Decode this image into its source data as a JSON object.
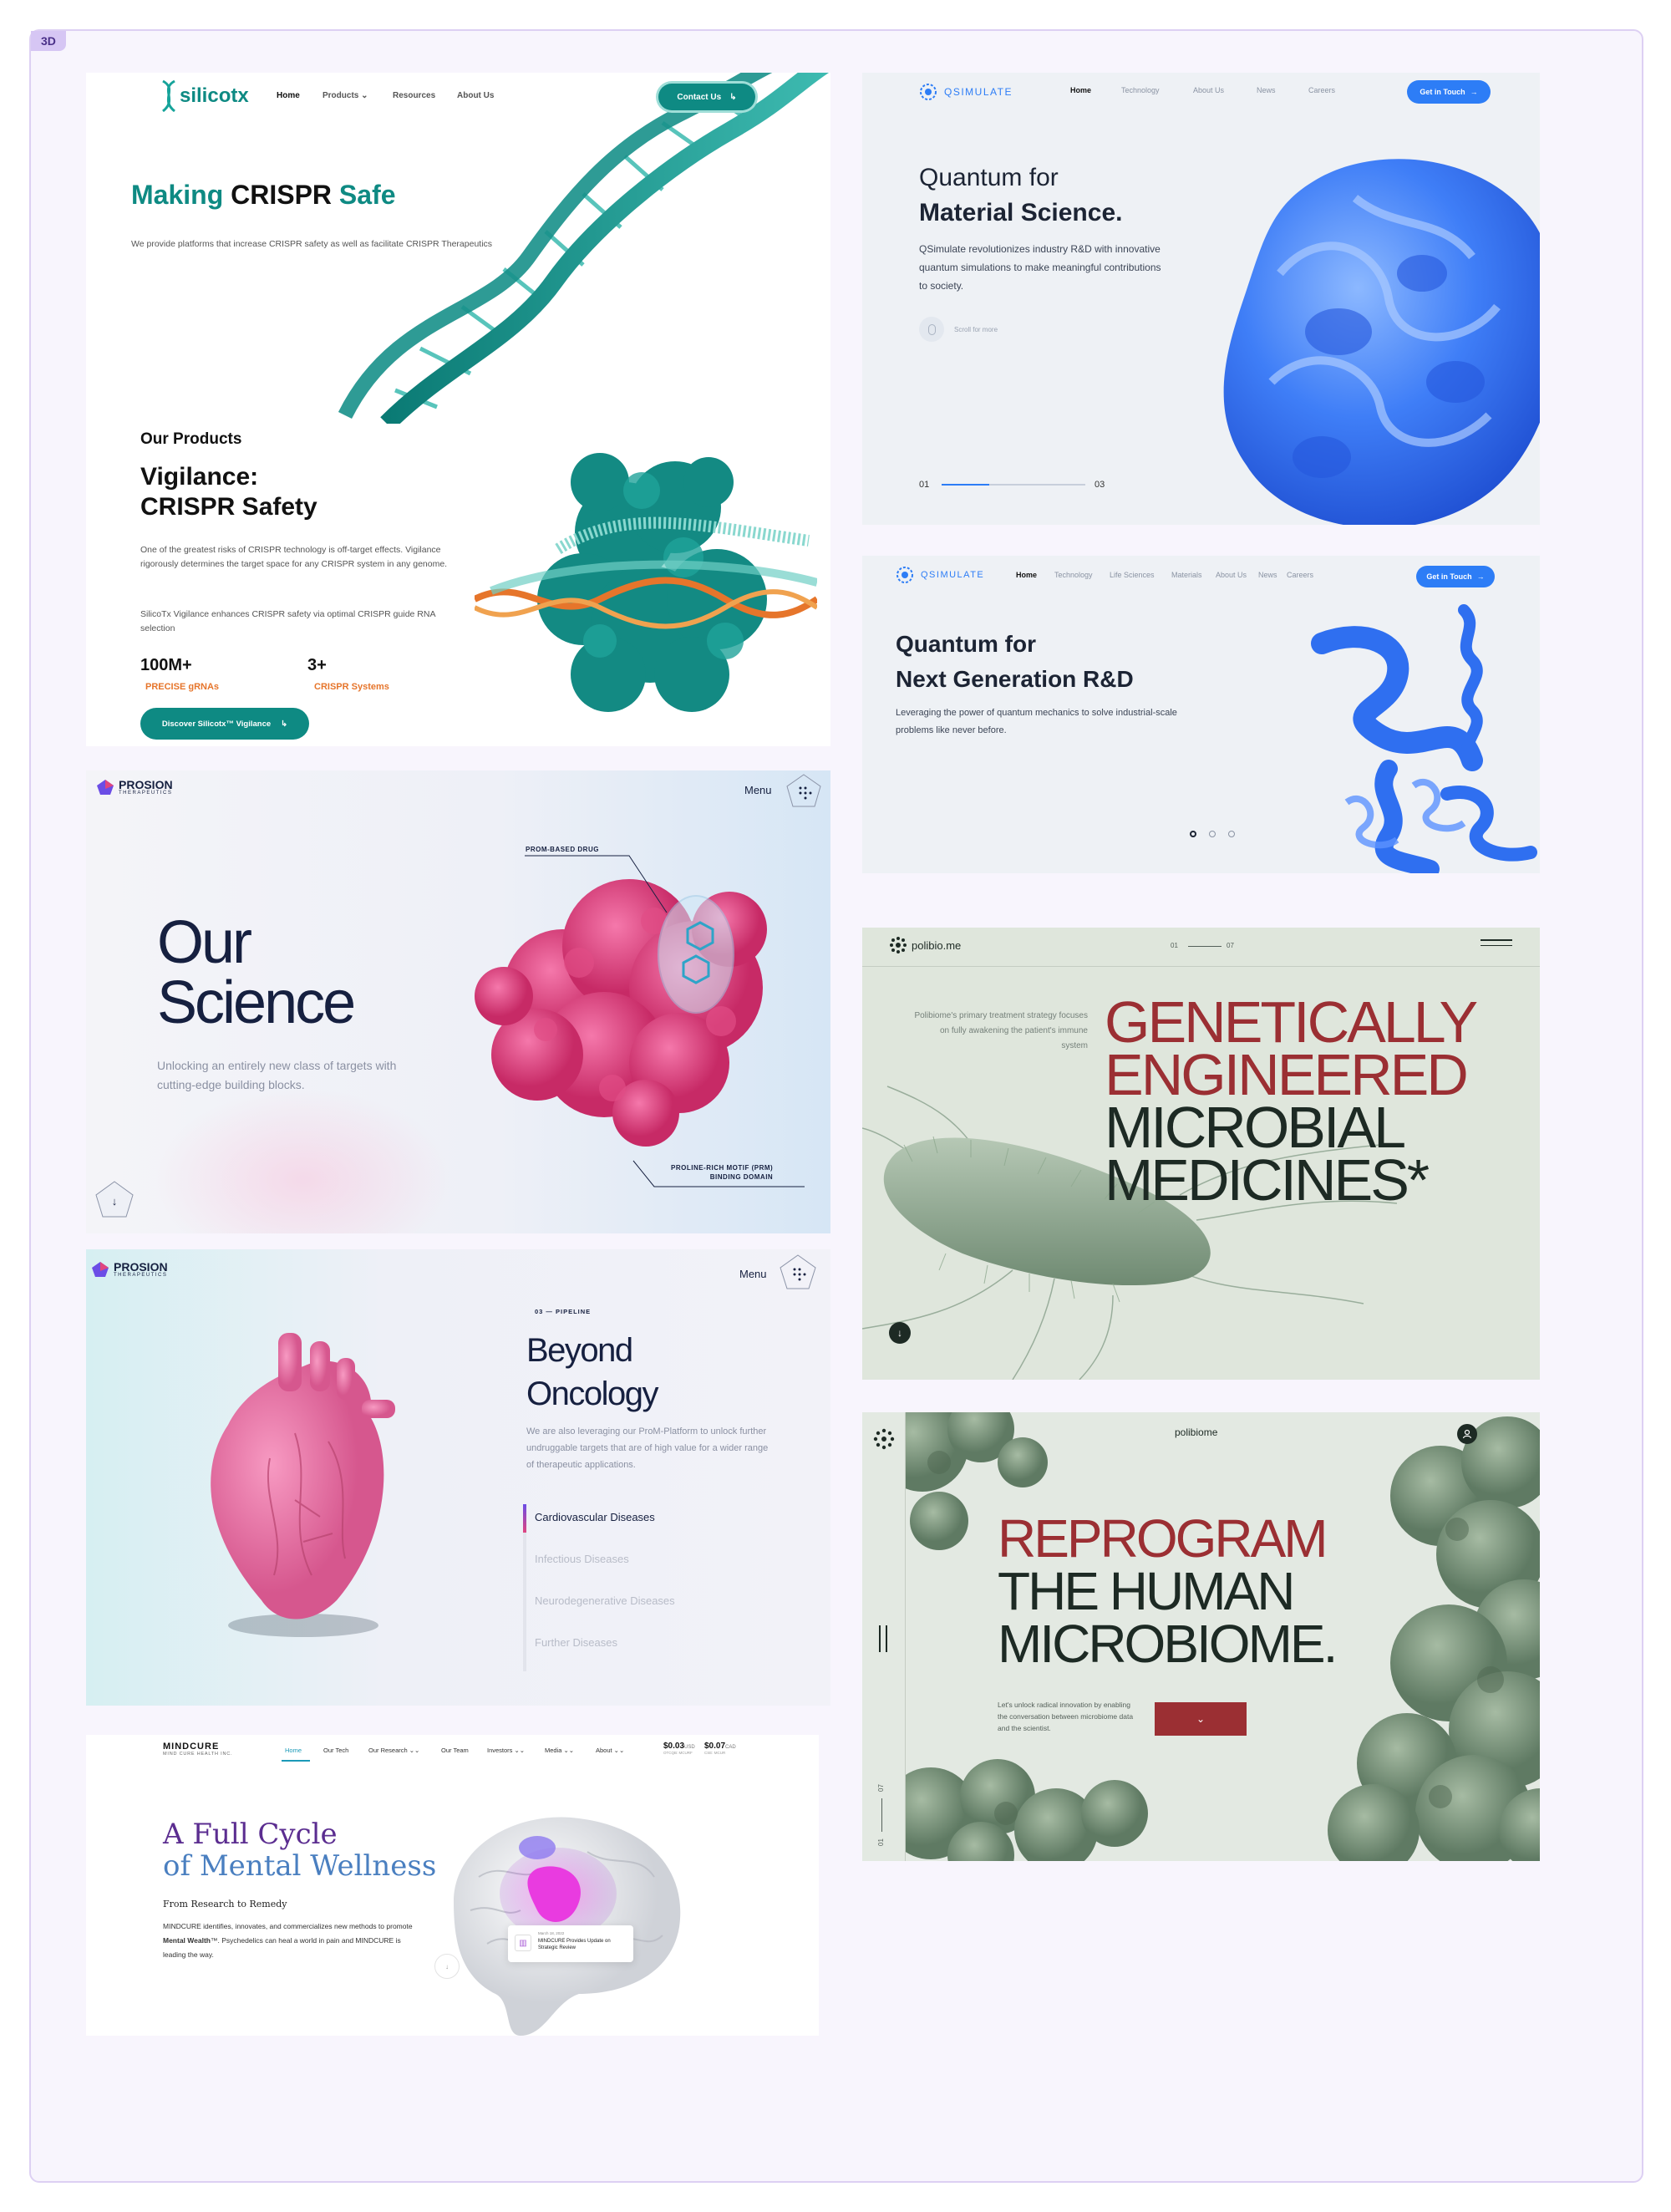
{
  "board_tag": "3D",
  "silicotx": {
    "logo": "silicotx",
    "nav": [
      "Home",
      "Products ⌄",
      "Resources",
      "About Us"
    ],
    "contact_button": "Contact Us",
    "hero_title_a": "Making ",
    "hero_title_b": "CRISPR",
    "hero_title_c": " Safe",
    "hero_text": "We provide platforms that increase CRISPR safety as well as facilitate CRISPR Therapeutics",
    "section_label": "Our Products",
    "product_title_1": "Vigilance:",
    "product_title_2": "CRISPR Safety",
    "product_text_1": "One of the greatest risks of CRISPR technology is off-target effects. Vigilance rigorously determines the target space for any CRISPR system in any genome.",
    "product_text_2": "SilicoTx Vigilance enhances CRISPR safety via optimal CRISPR guide RNA selection",
    "stats": [
      {
        "value": "100M+",
        "label": "PRECISE gRNAs"
      },
      {
        "value": "3+",
        "label": "CRISPR Systems"
      }
    ],
    "discover_button": "Discover Silicotx™ Vigilance",
    "colors": {
      "accent": "#0e8a83",
      "orange": "#e6752b"
    }
  },
  "qsimulate_1": {
    "logo": "QSIMULATE",
    "nav": [
      "Home",
      "Technology",
      "About Us",
      "News",
      "Careers"
    ],
    "cta": "Get in Touch",
    "title_1": "Quantum for",
    "title_2": "Material Science.",
    "text": "QSimulate revolutionizes industry R&D with innovative quantum simulations to make meaningful contributions to society.",
    "scroll_text": "Scroll for more",
    "slide_start": "01",
    "slide_end": "03",
    "colors": {
      "blue": "#2d7df6"
    }
  },
  "qsimulate_2": {
    "logo": "QSIMULATE",
    "nav": [
      "Home",
      "Technology",
      "Life Sciences",
      "Materials",
      "About Us",
      "News",
      "Careers"
    ],
    "cta": "Get in Touch",
    "title_1": "Quantum for",
    "title_2": "Next Generation R&D",
    "text": "Leveraging the power of quantum mechanics to solve industrial-scale problems like never before."
  },
  "prosion_1": {
    "logo": "PROSION",
    "logo_sub": "THERAPEUTICS",
    "menu": "Menu",
    "title_1": "Our",
    "title_2": "Science",
    "text": "Unlocking an entirely new class of targets with cutting-edge building blocks.",
    "annotation_top": "PROM-BASED DRUG",
    "annotation_bottom_1": "PROLINE-RICH MOTIF (PRM)",
    "annotation_bottom_2": "BINDING DOMAIN",
    "colors": {
      "pink": "#e0457f",
      "navy": "#162040"
    }
  },
  "prosion_2": {
    "logo": "PROSION",
    "logo_sub": "THERAPEUTICS",
    "menu": "Menu",
    "eyebrow": "03 — PIPELINE",
    "title_1": "Beyond",
    "title_2": "Oncology",
    "text": "We are also leveraging our ProM-Platform to unlock further undruggable targets that are of high value for a wider range of therapeutic applications.",
    "list": [
      "Cardiovascular Diseases",
      "Infectious Diseases",
      "Neurodegenerative Diseases",
      "Further Diseases"
    ]
  },
  "mindcure": {
    "logo": "MINDCURE",
    "logo_sub": "MIND CURE HEALTH INC.",
    "nav": [
      "Home",
      "Our Tech",
      "Our Research ⌄⌄",
      "Our Team",
      "Investors ⌄⌄",
      "Media ⌄⌄",
      "About ⌄⌄"
    ],
    "ticker_1_value": "$0.03",
    "ticker_1_cur": "USD",
    "ticker_1_sym": "OTCQB: MCURF",
    "ticker_2_value": "$0.07",
    "ticker_2_cur": "CAD",
    "ticker_2_sym": "CSE: MCUR",
    "title_1": "A Full Cycle",
    "title_2": "of Mental Wellness",
    "subtitle": "From Research to Remedy",
    "text_a": "MINDCURE identifies, innovates, and commercializes new methods to promote ",
    "text_b": "Mental Wealth",
    "text_c": "™. Psychedelics can heal a world in pain and MINDCURE is leading the way.",
    "news_date": "March 18, 2022",
    "news_title": "MINDCURE Provides Update on Strategic Review"
  },
  "polibiome_1": {
    "logo": "polibio.me",
    "slide_start": "01",
    "slide_end": "07",
    "side_text": "Polibiome's primary treatment strategy focuses on fully awakening the patient's immune system",
    "headline_1": "GENETICALLY",
    "headline_2": "ENGINEERED",
    "headline_3": "MICROBIAL",
    "headline_4": "MEDICINES*",
    "colors": {
      "red": "#9b2f33",
      "dark": "#1d2a24"
    }
  },
  "polibiome_2": {
    "logo": "polibiome",
    "headline_1": "REPROGRAM",
    "headline_2": "THE HUMAN",
    "headline_3": "MICROBIOME.",
    "text": "Let's unlock radical innovation by enabling the conversation between microbiome data and the scientist.",
    "slide_start": "01",
    "slide_end": "07"
  }
}
